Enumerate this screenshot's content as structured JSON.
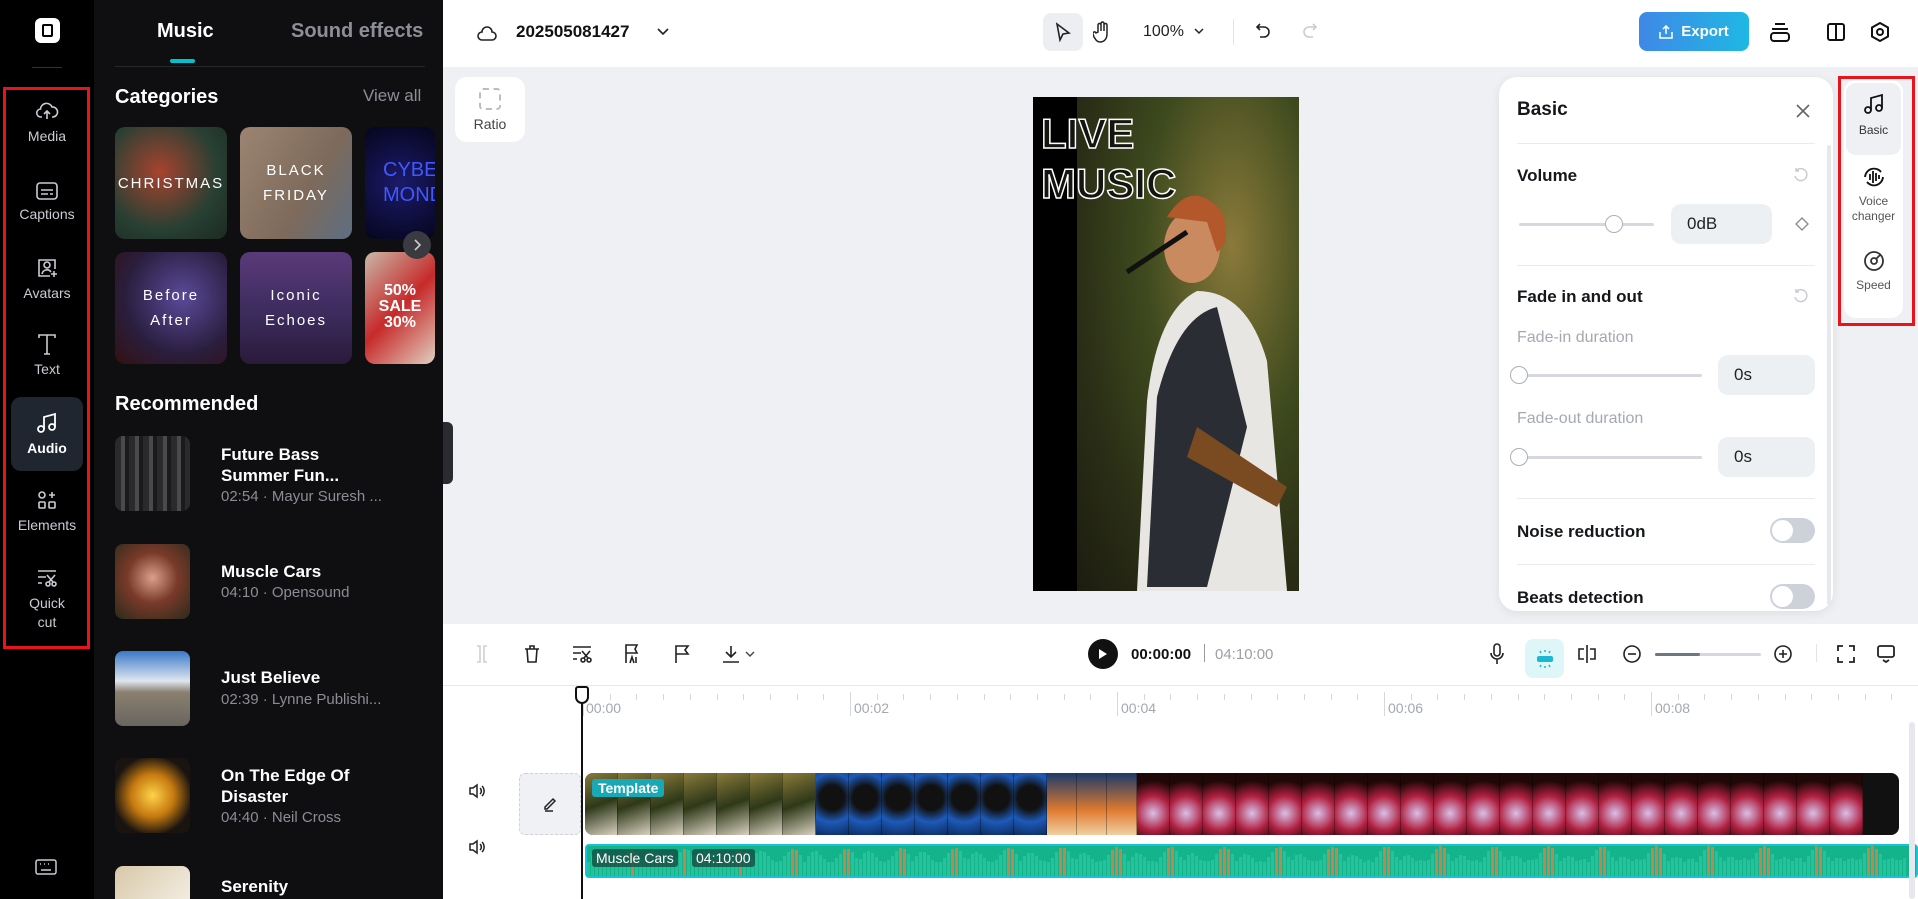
{
  "rail": {
    "items": [
      {
        "label": "Media",
        "icon": "cloud-upload-icon"
      },
      {
        "label": "Captions",
        "icon": "captions-icon"
      },
      {
        "label": "Avatars",
        "icon": "avatar-icon"
      },
      {
        "label": "Text",
        "icon": "text-icon"
      },
      {
        "label": "Audio",
        "icon": "music-note-icon",
        "active": true
      },
      {
        "label": "Elements",
        "icon": "elements-icon"
      },
      {
        "label": "Quick cut",
        "icon": "quick-cut-icon"
      }
    ]
  },
  "panel": {
    "tabs": [
      {
        "label": "Music",
        "active": true
      },
      {
        "label": "Sound effects"
      }
    ],
    "categories_title": "Categories",
    "view_all": "View all",
    "categories": [
      {
        "label": "CHRISTMAS"
      },
      {
        "label": "BLACK FRIDAY"
      },
      {
        "label": "CYBER MONDAY"
      },
      {
        "label": "Before After"
      },
      {
        "label": "Iconic Echoes"
      },
      {
        "label": "50% SALE 30%"
      }
    ],
    "recommended_title": "Recommended",
    "songs": [
      {
        "title": "Future Bass Summer Fun...",
        "meta": "02:54 · Mayur Suresh ..."
      },
      {
        "title": "Muscle Cars",
        "meta": "04:10 · Opensound"
      },
      {
        "title": "Just Believe",
        "meta": "02:39 · Lynne Publishi..."
      },
      {
        "title": "On The Edge Of Disaster",
        "meta": "04:40 · Neil Cross"
      },
      {
        "title": "Serenity",
        "meta": ""
      }
    ]
  },
  "topbar": {
    "project_title": "202505081427",
    "zoom": "100%",
    "export_label": "Export"
  },
  "canvas": {
    "ratio_label": "Ratio",
    "overlay_text_1": "LIVE",
    "overlay_text_2": "MUSIC"
  },
  "basic": {
    "title": "Basic",
    "volume_label": "Volume",
    "volume_value": "0dB",
    "volume_fraction": 0.7,
    "fade_label": "Fade in and out",
    "fade_in_label": "Fade-in duration",
    "fade_in_value": "0s",
    "fade_out_label": "Fade-out duration",
    "fade_out_value": "0s",
    "noise_label": "Noise reduction",
    "noise_on": false,
    "beats_label": "Beats detection",
    "beats_on": false
  },
  "right_rail": {
    "items": [
      {
        "label": "Basic"
      },
      {
        "label": "Voice changer"
      },
      {
        "label": "Speed"
      }
    ]
  },
  "timeline": {
    "current_time": "00:00:00",
    "total_time": "04:10:00",
    "ruler": [
      "00:00",
      "00:02",
      "00:04",
      "00:06",
      "00:08"
    ],
    "video_badge": "Template",
    "audio_name": "Muscle Cars",
    "audio_duration": "04:10:00",
    "zoom_fraction": 0.42
  },
  "colors": {
    "accent": "#00c1cd",
    "audio_track": "#13b38b",
    "export_from": "#3f88e6",
    "export_to": "#1fb8e4"
  }
}
